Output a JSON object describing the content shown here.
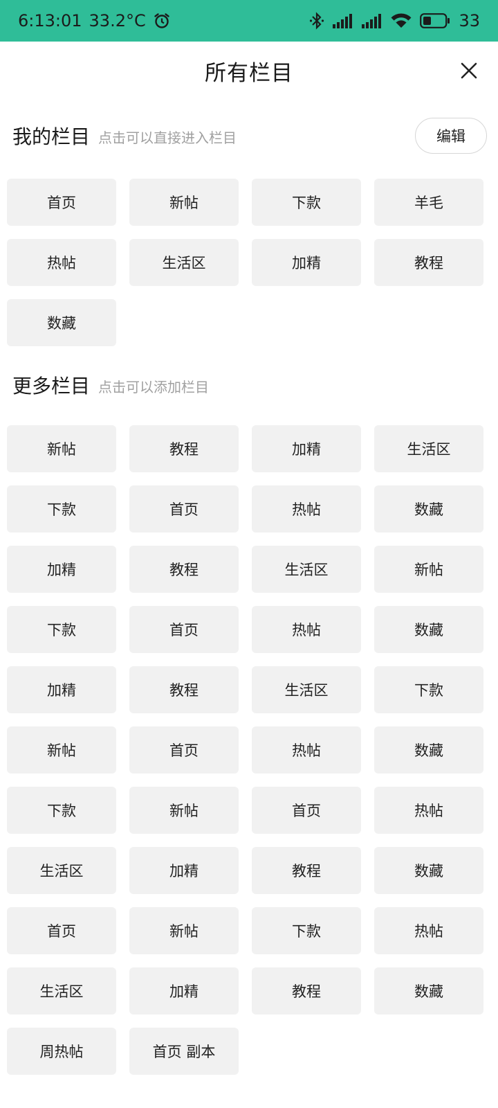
{
  "status_bar": {
    "time": "6:13:01",
    "temperature": "33.2°C",
    "battery_level": "33",
    "icons": [
      "alarm-icon",
      "bluetooth-icon",
      "signal-icon",
      "signal-icon",
      "wifi-icon",
      "battery-icon"
    ],
    "bar_color": "#2fbd98"
  },
  "header": {
    "title": "所有栏目",
    "close_icon": "close-icon"
  },
  "my_section": {
    "title": "我的栏目",
    "hint": "点击可以直接进入栏目",
    "edit_label": "编辑",
    "items": [
      "首页",
      "新帖",
      "下款",
      "羊毛",
      "热帖",
      "生活区",
      "加精",
      "教程",
      "数藏"
    ]
  },
  "more_section": {
    "title": "更多栏目",
    "hint": "点击可以添加栏目",
    "items": [
      "新帖",
      "教程",
      "加精",
      "生活区",
      "下款",
      "首页",
      "热帖",
      "数藏",
      "加精",
      "教程",
      "生活区",
      "新帖",
      "下款",
      "首页",
      "热帖",
      "数藏",
      "加精",
      "教程",
      "生活区",
      "下款",
      "新帖",
      "首页",
      "热帖",
      "数藏",
      "下款",
      "新帖",
      "首页",
      "热帖",
      "生活区",
      "加精",
      "教程",
      "数藏",
      "首页",
      "新帖",
      "下款",
      "热帖",
      "生活区",
      "加精",
      "教程",
      "数藏",
      "周热帖",
      "首页 副本"
    ]
  }
}
